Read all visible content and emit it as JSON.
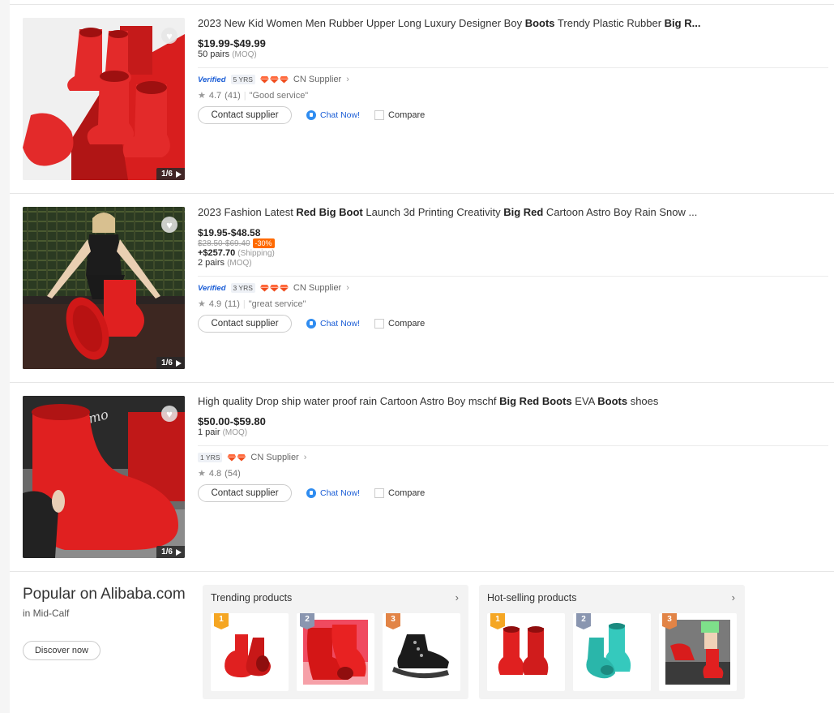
{
  "products": [
    {
      "title_parts": [
        {
          "t": "2023 New Kid Women Men Rubber Upper Long Luxury Designer Boy ",
          "b": false
        },
        {
          "t": "Boots",
          "b": true
        },
        {
          "t": " Trendy Plastic Rubber ",
          "b": false
        },
        {
          "t": "Big R...",
          "b": true
        }
      ],
      "price": "$19.99-$49.99",
      "moq_qty": "50 pairs",
      "moq_label": "(MOQ)",
      "verified": "Verified",
      "years": "5 YRS",
      "gems": 3,
      "supplier_type": "CN Supplier",
      "rating": "4.7",
      "reviews": "(41)",
      "review_quote": "\"Good service\"",
      "contact_label": "Contact supplier",
      "chat_label": "Chat Now!",
      "compare_label": "Compare",
      "image_count": "1/6"
    },
    {
      "title_parts": [
        {
          "t": "2023 Fashion Latest ",
          "b": false
        },
        {
          "t": "Red Big Boot",
          "b": true
        },
        {
          "t": " Launch 3d Printing Creativity ",
          "b": false
        },
        {
          "t": "Big Red",
          "b": true
        },
        {
          "t": " Cartoon Astro Boy Rain Snow ...",
          "b": false
        }
      ],
      "price": "$19.95-$48.58",
      "old_price": "$28.50-$69.40",
      "discount": "-30%",
      "shipping": "+$257.70",
      "shipping_label": "(Shipping)",
      "moq_qty": "2 pairs",
      "moq_label": "(MOQ)",
      "verified": "Verified",
      "years": "3 YRS",
      "gems": 3,
      "supplier_type": "CN Supplier",
      "rating": "4.9",
      "reviews": "(11)",
      "review_quote": "\"great service\"",
      "contact_label": "Contact supplier",
      "chat_label": "Chat Now!",
      "compare_label": "Compare",
      "image_count": "1/6"
    },
    {
      "title_parts": [
        {
          "t": "High quality Drop ship water proof rain Cartoon Astro Boy mschf ",
          "b": false
        },
        {
          "t": "Big Red Boots",
          "b": true
        },
        {
          "t": " EVA ",
          "b": false
        },
        {
          "t": "Boots",
          "b": true
        },
        {
          "t": " shoes",
          "b": false
        }
      ],
      "price": "$50.00-$59.80",
      "moq_qty": "1 pair",
      "moq_label": "(MOQ)",
      "years": "1 YRS",
      "gems": 2,
      "supplier_type": "CN Supplier",
      "rating": "4.8",
      "reviews": "(54)",
      "contact_label": "Contact supplier",
      "chat_label": "Chat Now!",
      "compare_label": "Compare",
      "image_count": "1/6"
    }
  ],
  "popular": {
    "title": "Popular on Alibaba.com",
    "subtitle": "in Mid-Calf",
    "discover_label": "Discover now",
    "panels": [
      {
        "title": "Trending products",
        "ranks": [
          "1",
          "2",
          "3"
        ]
      },
      {
        "title": "Hot-selling products",
        "ranks": [
          "1",
          "2",
          "3"
        ]
      }
    ]
  },
  "colors": {
    "accent": "#ff6a00",
    "link": "#1a5dd6",
    "boot_red": "#e02020",
    "boot_teal": "#2ec4b6"
  }
}
